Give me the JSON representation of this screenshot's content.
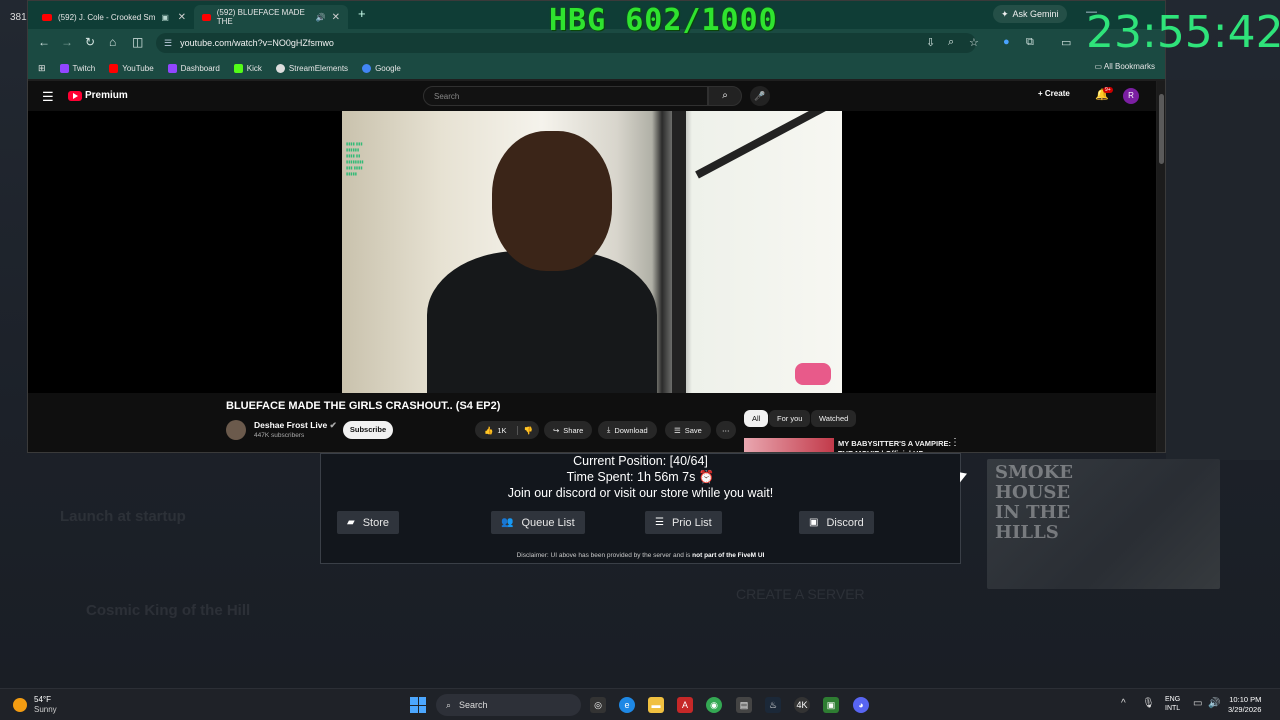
{
  "overlay": {
    "counter": "HBG 602/1000",
    "clock": "23:55:42",
    "edge_number": "381"
  },
  "browser": {
    "tabs": [
      {
        "title": "(592) J. Cole - Crooked Sm"
      },
      {
        "title": "(592) BLUEFACE MADE THE"
      }
    ],
    "ask_gemini": "Ask Gemini",
    "url": "youtube.com/watch?v=NO0gHZfsmwo",
    "bookmarks": [
      "Twitch",
      "YouTube",
      "Dashboard",
      "Kick",
      "StreamElements",
      "Google"
    ],
    "all_bookmarks": "All Bookmarks"
  },
  "youtube": {
    "logo": "Premium",
    "search_placeholder": "Search",
    "create": "Create",
    "notif_badge": "9+",
    "avatar_letter": "R",
    "video_title": "BLUEFACE MADE THE GIRLS CRASHOUT.. (S4 EP2)",
    "channel_name": "Deshae Frost Live",
    "subscribers": "447K subscribers",
    "subscribe": "Subscribe",
    "likes": "1K",
    "share": "Share",
    "download": "Download",
    "save": "Save",
    "chips": [
      "All",
      "For you",
      "Watched"
    ],
    "rec_title": "MY BABYSITTER'S A VAMPIRE: THE MOVIE | Official HD"
  },
  "queue": {
    "position": "Current Position: [40/64]",
    "time_spent": "Time Spent: 1h 56m 7s ⏰",
    "message": "Join our discord or visit our store while you wait!",
    "buttons": {
      "store": "Store",
      "queue_list": "Queue List",
      "prio_list": "Prio List",
      "discord": "Discord"
    },
    "disclaimer_prefix": "Disclaimer: UI above has been provided by the server and is ",
    "disclaimer_bold": "not part of the FiveM UI"
  },
  "taskbar": {
    "temp": "54°F",
    "weather": "Sunny",
    "search": "Search",
    "lang1": "ENG",
    "lang2": "INTL",
    "time": "10:10 PM",
    "date": "3/29/2026"
  }
}
